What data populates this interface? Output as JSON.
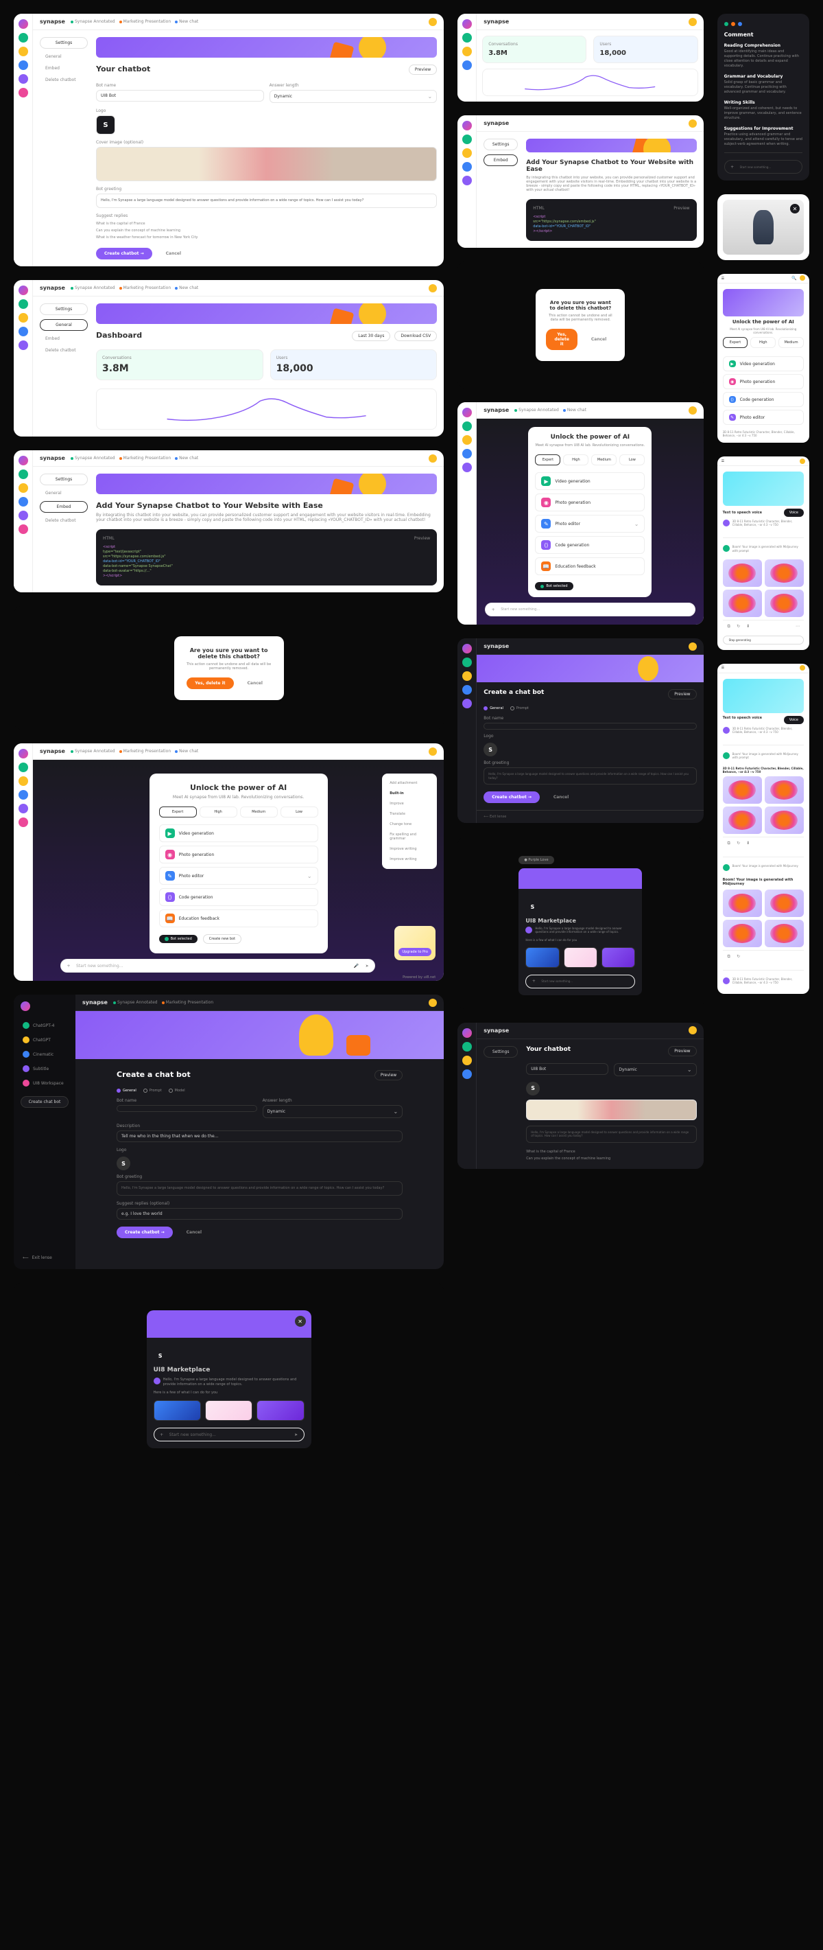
{
  "brand": "synapse",
  "crumbs": {
    "c1": "Synapse Annotated",
    "c2": "Marketing Presentation",
    "c3": "New chat"
  },
  "chart_data": {
    "type": "line",
    "x": [
      0,
      1,
      2,
      3,
      4,
      5,
      6,
      7,
      8,
      9
    ],
    "y": [
      20,
      18,
      22,
      35,
      55,
      60,
      45,
      30,
      28,
      32
    ],
    "ylim": [
      0,
      70
    ]
  },
  "chatbot": {
    "title": "Your chatbot",
    "preview": "Preview",
    "name_label": "Bot name",
    "name_value": "UI8 Bot",
    "answer_label": "Answer length",
    "answer_value": "Dynamic",
    "logo_label": "Logo",
    "logo_letter": "S",
    "cover_label": "Cover image (optional)",
    "greeting_label": "Bot greeting",
    "greeting_text": "Hello, I'm Synapse a large language model designed to answer questions and provide information on a wide range of topics. How can I assist you today?",
    "suggest_label": "Suggest replies",
    "suggest1": "What is the capital of France",
    "suggest2": "Can you explain the concept of machine learning",
    "suggest3": "What is the weather forecast for tomorrow in New York City",
    "create": "Create chatbot →",
    "cancel": "Cancel"
  },
  "sidebar": {
    "settings": "Settings",
    "general": "General",
    "embed": "Embed",
    "delete": "Delete chatbot"
  },
  "dashboard": {
    "title": "Dashboard",
    "period": "Last 30 days",
    "download": "Download CSV",
    "stat1_label": "Conversations",
    "stat1_value": "3.8M",
    "stat2_label": "Users",
    "stat2_value": "18,000"
  },
  "embed": {
    "title": "Add Your Synapse Chatbot to Your Website with Ease",
    "desc": "By integrating this chatbot into your website, you can provide personalized customer support and engagement with your website visitors in real-time. Embedding your chatbot into your website is a breeze - simply copy and paste the following code into your HTML, replacing «YOUR_CHATBOT_ID» with your actual chatbot!",
    "html_label": "HTML",
    "preview": "Preview",
    "code1": "<script",
    "code2": "type=\"text/javascript\"",
    "code3": "src=\"https://synapse.com/embed.js\"",
    "code4": "data-bot-id=\"YOUR_CHATBOT_ID\"",
    "code5": "data-bot-name=\"Synapse SynapseChat\"",
    "code6": "data-bot-avatar=\"https://...\"",
    "code7": "></script>"
  },
  "delete_modal": {
    "title": "Are you sure you want to delete this chatbot?",
    "text": "This action cannot be undone and all data will be permanently removed.",
    "yes": "Yes, delete it",
    "cancel": "Cancel"
  },
  "unlock": {
    "title": "Unlock the power of AI",
    "sub": "Meet AI synapse from UI8 AI lab. Revolutionizing conversations.",
    "tabs": {
      "t1": "Expert",
      "t2": "High",
      "t3": "Medium",
      "t4": "Low"
    },
    "opts": {
      "video": "Video generation",
      "photo": "Photo generation",
      "photo_edit": "Photo editor",
      "code": "Code generation",
      "edu": "Education feedback"
    },
    "bot_selected": "Bot selected",
    "create_bot": "Create new bot",
    "upgrade": "Upgrade to Pro",
    "search_ph": "Start new something..."
  },
  "right_menu": {
    "r1": "Add attachment",
    "r2": "Built-in",
    "r3": "Improve",
    "r4": "Translate",
    "r5": "Change tone",
    "r6": "Fix spelling and grammar",
    "r7": "Improve writing",
    "r8": "Improve writing"
  },
  "create": {
    "title": "Create a chat bot",
    "step1": "General",
    "step2": "Prompt",
    "step3": "Model",
    "preview": "Preview",
    "name_label": "Bot name",
    "desc_label": "Description",
    "desc_ph": "Tell me who in the thing that when we do the...",
    "greeting_label": "Bot greeting",
    "suggest_label": "Suggest replies (optional)",
    "suggest_ph": "e.g. I love the world"
  },
  "dark_sidebar": {
    "s1": "ChatGPT-4",
    "s2": "ChatGPT",
    "s3": "Cinematic",
    "s4": "Subtitle",
    "s5": "UI8 Workspace",
    "create": "Create chat bot",
    "exit": "Exit lense"
  },
  "chat_widget": {
    "title": "UI8 Marketplace",
    "greeting": "Hello, I'm Synapse a large language model designed to answer questions and provide information on a wide range of topics.",
    "prompt_label": "Here is a few of what I can do for you",
    "input_ph": "Start new something..."
  },
  "comment": {
    "title": "Comment",
    "h1": "Reading Comprehension",
    "t1": "Good at identifying main ideas and supporting details. Continue practicing with close attention to details and expand vocabulary.",
    "h2": "Grammar and Vocabulary",
    "t2": "Solid grasp of basic grammar and vocabulary. Continue practicing with advanced grammar and vocabulary.",
    "h3": "Writing Skills",
    "t3": "Well-organized and coherent, but needs to improve grammar, vocabulary, and sentence structure.",
    "h4": "Suggestions for Improvement",
    "t4": "Practice using advanced grammar and vocabulary, and attend carefully to tense and subject-verb agreement when writing."
  },
  "mobile": {
    "tts": "Text to speech voice",
    "voice": "Voice",
    "prompt_title": "3D 8-11 Retro Futuristic Character, Blender, Cillable, Behance, --ar 4:3 --v 750",
    "regen": "Boom! Your image is generated with Midjourney with prompt",
    "regen2": "Boom! Your image is generated with Midjourney",
    "stop": "Stop generating"
  },
  "footer": {
    "powered": "Powered by ui8.net"
  }
}
